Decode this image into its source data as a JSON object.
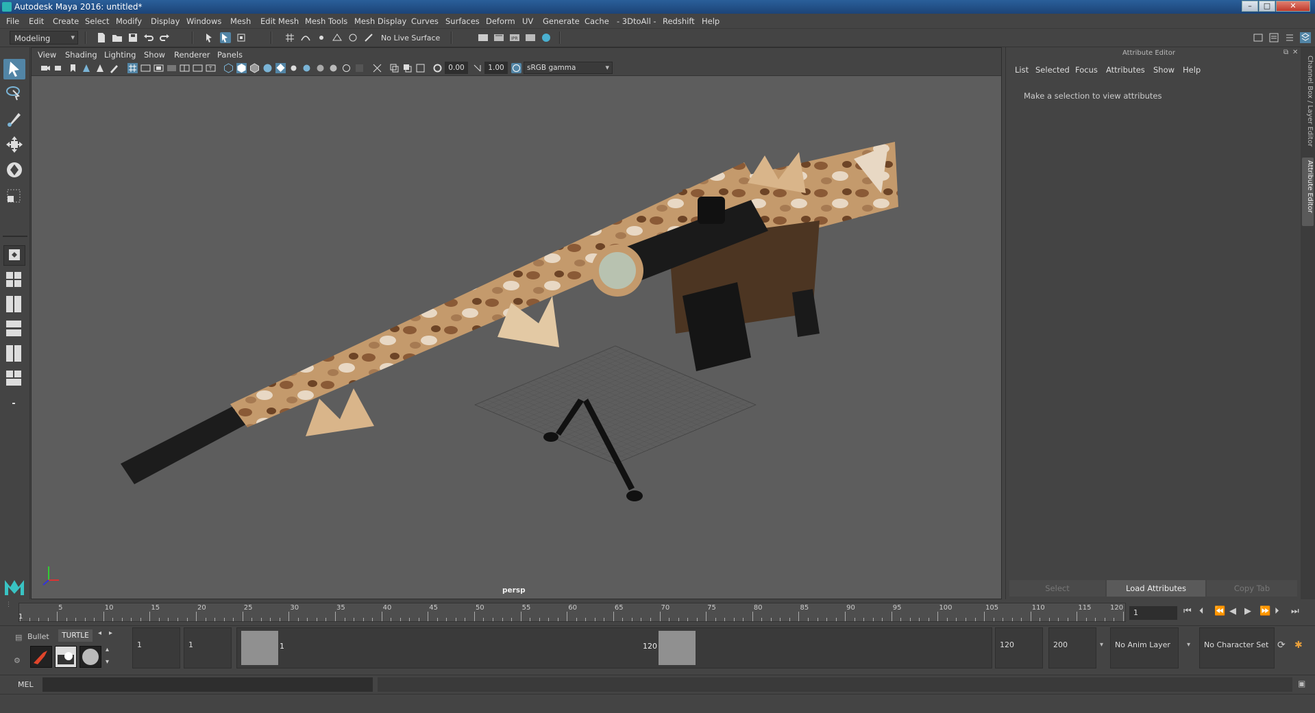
{
  "window": {
    "title": "Autodesk Maya 2016: untitled*",
    "min": "–",
    "max": "□",
    "close": "✕"
  },
  "menu": [
    "File",
    "Edit",
    "Create",
    "Select",
    "Modify",
    "Display",
    "Windows",
    "Mesh",
    "Edit Mesh",
    "Mesh Tools",
    "Mesh Display",
    "Curves",
    "Surfaces",
    "Deform",
    "UV",
    "Generate",
    "Cache",
    "- 3DtoAll -",
    "Redshift",
    "Help"
  ],
  "status": {
    "mode": "Modeling",
    "live_surface": "No Live Surface"
  },
  "viewport": {
    "menu": [
      "View",
      "Shading",
      "Lighting",
      "Show",
      "Renderer",
      "Panels"
    ],
    "exposure": "0.00",
    "gamma": "1.00",
    "color_space": "sRGB gamma",
    "camera": "persp"
  },
  "attribute_editor": {
    "title": "Attribute Editor",
    "menu": [
      "List",
      "Selected",
      "Focus",
      "Attributes",
      "Show",
      "Help"
    ],
    "message": "Make a selection to view attributes",
    "buttons": {
      "select": "Select",
      "load": "Load Attributes",
      "copy": "Copy Tab"
    }
  },
  "side_tabs": {
    "channel_box": "Channel Box / Layer Editor",
    "attribute_editor": "Attribute Editor"
  },
  "timeline": {
    "ticks": [
      "5",
      "10",
      "15",
      "20",
      "25",
      "30",
      "35",
      "40",
      "45",
      "50",
      "55",
      "60",
      "65",
      "70",
      "75",
      "80",
      "85",
      "90",
      "95",
      "100",
      "105",
      "110",
      "115",
      "120"
    ],
    "start_label": "1",
    "current_frame": "1"
  },
  "shelf": {
    "tabs": [
      "Bullet",
      "TURTLE"
    ]
  },
  "range": {
    "start": "1",
    "playback_start": "1",
    "range_min_label": "1",
    "range_max_label": "120",
    "playback_end": "120",
    "end": "200",
    "anim_layer": "No Anim Layer",
    "char_set": "No Character Set"
  },
  "cmd": {
    "label": "MEL"
  }
}
